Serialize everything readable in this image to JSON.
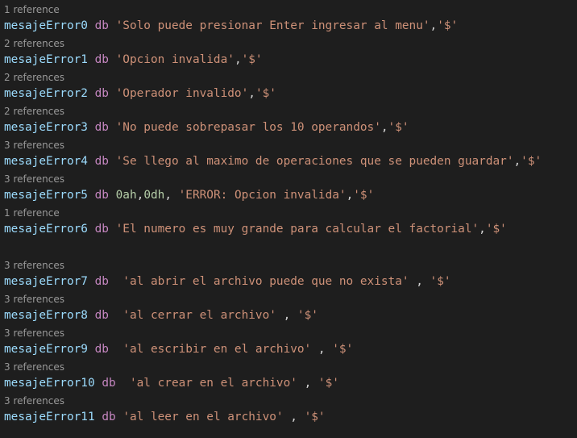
{
  "lines": [
    {
      "refs": "1 reference",
      "name": "mesajeError0",
      "tokens": [
        {
          "t": " ",
          "c": "pun"
        },
        {
          "t": "db",
          "c": "kw"
        },
        {
          "t": " ",
          "c": "pun"
        },
        {
          "t": "'Solo puede presionar Enter ingresar al menu'",
          "c": "str"
        },
        {
          "t": ",",
          "c": "pun"
        },
        {
          "t": "'$'",
          "c": "str"
        }
      ]
    },
    {
      "refs": "2 references",
      "name": "mesajeError1",
      "tokens": [
        {
          "t": " ",
          "c": "pun"
        },
        {
          "t": "db",
          "c": "kw"
        },
        {
          "t": " ",
          "c": "pun"
        },
        {
          "t": "'Opcion invalida'",
          "c": "str"
        },
        {
          "t": ",",
          "c": "pun"
        },
        {
          "t": "'$'",
          "c": "str"
        }
      ]
    },
    {
      "refs": "2 references",
      "name": "mesajeError2",
      "tokens": [
        {
          "t": " ",
          "c": "pun"
        },
        {
          "t": "db",
          "c": "kw"
        },
        {
          "t": " ",
          "c": "pun"
        },
        {
          "t": "'Operador invalido'",
          "c": "str"
        },
        {
          "t": ",",
          "c": "pun"
        },
        {
          "t": "'$'",
          "c": "str"
        }
      ]
    },
    {
      "refs": "2 references",
      "name": "mesajeError3",
      "tokens": [
        {
          "t": " ",
          "c": "pun"
        },
        {
          "t": "db",
          "c": "kw"
        },
        {
          "t": " ",
          "c": "pun"
        },
        {
          "t": "'No puede sobrepasar los 10 operandos'",
          "c": "str"
        },
        {
          "t": ",",
          "c": "pun"
        },
        {
          "t": "'$'",
          "c": "str"
        }
      ]
    },
    {
      "refs": "3 references",
      "name": "mesajeError4",
      "tokens": [
        {
          "t": " ",
          "c": "pun"
        },
        {
          "t": "db",
          "c": "kw"
        },
        {
          "t": " ",
          "c": "pun"
        },
        {
          "t": "'Se llego al maximo de operaciones que se pueden guardar'",
          "c": "str"
        },
        {
          "t": ",",
          "c": "pun"
        },
        {
          "t": "'$'",
          "c": "str"
        }
      ]
    },
    {
      "refs": "3 references",
      "name": "mesajeError5",
      "tokens": [
        {
          "t": " ",
          "c": "pun"
        },
        {
          "t": "db",
          "c": "kw"
        },
        {
          "t": " ",
          "c": "pun"
        },
        {
          "t": "0ah",
          "c": "num"
        },
        {
          "t": ",",
          "c": "pun"
        },
        {
          "t": "0dh",
          "c": "num"
        },
        {
          "t": ", ",
          "c": "pun"
        },
        {
          "t": "'ERROR: Opcion invalida'",
          "c": "str"
        },
        {
          "t": ",",
          "c": "pun"
        },
        {
          "t": "'$'",
          "c": "str"
        }
      ]
    },
    {
      "refs": "1 reference",
      "name": "mesajeError6",
      "tokens": [
        {
          "t": " ",
          "c": "pun"
        },
        {
          "t": "db",
          "c": "kw"
        },
        {
          "t": " ",
          "c": "pun"
        },
        {
          "t": "'El numero es muy grande para calcular el factorial'",
          "c": "str"
        },
        {
          "t": ",",
          "c": "pun"
        },
        {
          "t": "'$'",
          "c": "str"
        }
      ]
    },
    {
      "refs": "3 references",
      "name": "mesajeError7",
      "tokens": [
        {
          "t": " ",
          "c": "pun"
        },
        {
          "t": "db",
          "c": "kw"
        },
        {
          "t": "  ",
          "c": "pun"
        },
        {
          "t": "'al abrir el archivo puede que no exista'",
          "c": "str"
        },
        {
          "t": " , ",
          "c": "pun"
        },
        {
          "t": "'$'",
          "c": "str"
        }
      ]
    },
    {
      "refs": "3 references",
      "name": "mesajeError8",
      "tokens": [
        {
          "t": " ",
          "c": "pun"
        },
        {
          "t": "db",
          "c": "kw"
        },
        {
          "t": "  ",
          "c": "pun"
        },
        {
          "t": "'al cerrar el archivo'",
          "c": "str"
        },
        {
          "t": " , ",
          "c": "pun"
        },
        {
          "t": "'$'",
          "c": "str"
        }
      ]
    },
    {
      "refs": "3 references",
      "name": "mesajeError9",
      "tokens": [
        {
          "t": " ",
          "c": "pun"
        },
        {
          "t": "db",
          "c": "kw"
        },
        {
          "t": "  ",
          "c": "pun"
        },
        {
          "t": "'al escribir en el archivo'",
          "c": "str"
        },
        {
          "t": " , ",
          "c": "pun"
        },
        {
          "t": "'$'",
          "c": "str"
        }
      ]
    },
    {
      "refs": "3 references",
      "name": "mesajeError10",
      "tokens": [
        {
          "t": " ",
          "c": "pun"
        },
        {
          "t": "db",
          "c": "kw"
        },
        {
          "t": "  ",
          "c": "pun"
        },
        {
          "t": "'al crear en el archivo'",
          "c": "str"
        },
        {
          "t": " , ",
          "c": "pun"
        },
        {
          "t": "'$'",
          "c": "str"
        }
      ]
    },
    {
      "refs": "3 references",
      "name": "mesajeError11",
      "tokens": [
        {
          "t": " ",
          "c": "pun"
        },
        {
          "t": "db",
          "c": "kw"
        },
        {
          "t": " ",
          "c": "pun"
        },
        {
          "t": "'al leer en el archivo'",
          "c": "str"
        },
        {
          "t": " , ",
          "c": "pun"
        },
        {
          "t": "'$'",
          "c": "str"
        }
      ]
    }
  ]
}
